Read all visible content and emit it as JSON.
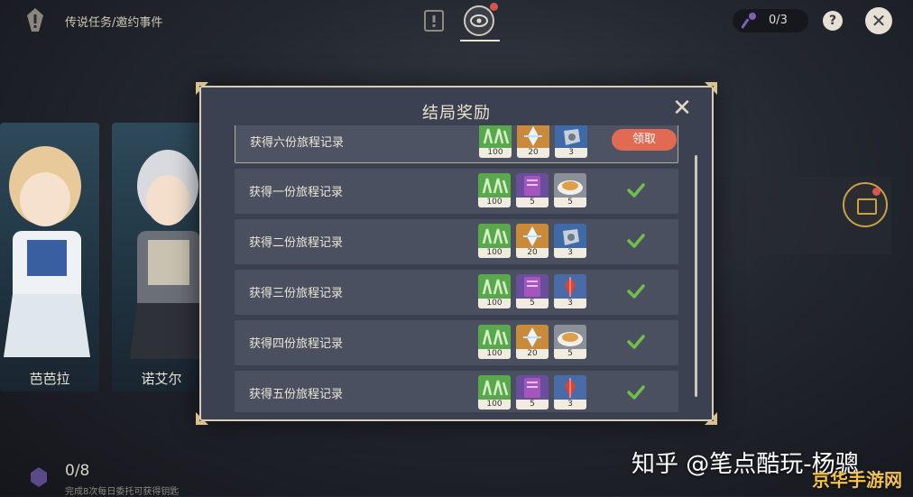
{
  "topbar": {
    "breadcrumb": "传说任务/邀约事件",
    "key_counter": "0/3",
    "help_label": "?",
    "close_label": "✕"
  },
  "characters": [
    {
      "name": "芭芭拉"
    },
    {
      "name": "诺艾尔"
    }
  ],
  "bottom": {
    "progress": "0/8",
    "progress_desc": "完成8次每日委托可获得钥匙"
  },
  "modal": {
    "title": "结局奖励",
    "close_label": "✕",
    "rows": [
      {
        "label": "获得六份旅程记录",
        "rewards": [
          {
            "icon": "adventure-exp-icon",
            "count": "100"
          },
          {
            "icon": "primogem-icon",
            "count": "20"
          },
          {
            "icon": "hero-wit-icon",
            "count": "3"
          }
        ],
        "status": "claimable",
        "claim_label": "领取"
      },
      {
        "label": "获得一份旅程记录",
        "rewards": [
          {
            "icon": "adventure-exp-icon",
            "count": "100"
          },
          {
            "icon": "talent-book-icon",
            "count": "5"
          },
          {
            "icon": "dish-icon",
            "count": "5"
          }
        ],
        "status": "claimed"
      },
      {
        "label": "获得二份旅程记录",
        "rewards": [
          {
            "icon": "adventure-exp-icon",
            "count": "100"
          },
          {
            "icon": "primogem-icon",
            "count": "20"
          },
          {
            "icon": "hero-wit-icon",
            "count": "3"
          }
        ],
        "status": "claimed"
      },
      {
        "label": "获得三份旅程记录",
        "rewards": [
          {
            "icon": "adventure-exp-icon",
            "count": "100"
          },
          {
            "icon": "talent-book-icon",
            "count": "5"
          },
          {
            "icon": "red-crystal-icon",
            "count": "3"
          }
        ],
        "status": "claimed"
      },
      {
        "label": "获得四份旅程记录",
        "rewards": [
          {
            "icon": "adventure-exp-icon",
            "count": "100"
          },
          {
            "icon": "primogem-icon",
            "count": "20"
          },
          {
            "icon": "dish-icon",
            "count": "5"
          }
        ],
        "status": "claimed"
      },
      {
        "label": "获得五份旅程记录",
        "rewards": [
          {
            "icon": "adventure-exp-icon",
            "count": "100"
          },
          {
            "icon": "talent-book-icon",
            "count": "5"
          },
          {
            "icon": "red-crystal-icon",
            "count": "3"
          }
        ],
        "status": "claimed"
      }
    ]
  },
  "watermark": {
    "text": "知乎 @笔点酷玩-杨骢",
    "site": "京华手游网"
  },
  "colors": {
    "accent_gold": "#c9a648",
    "claim_button": "#e06a52",
    "check_green": "#6fbf4a",
    "modal_bg": "#3b4150"
  }
}
